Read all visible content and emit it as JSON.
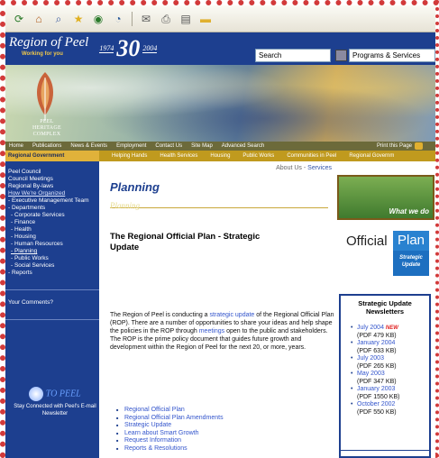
{
  "header": {
    "logo": "Region of Peel",
    "tagline": "Working for you",
    "year_start": "1974",
    "anniv_number": "30",
    "year_end": "2004",
    "anniv_caption": "years of working for you",
    "search_value": "Search",
    "services_select": "Programs & Services"
  },
  "banner": {
    "text_line1": "PEEL",
    "text_line2": "HERITAGE",
    "text_line3": "COMPLEX"
  },
  "nav": {
    "items": [
      "Home",
      "Publications",
      "News & Events",
      "Employment",
      "Contact Us",
      "Site Map",
      "Advanced Search"
    ],
    "print": "Print this Page"
  },
  "subnav": {
    "current": "Regional Government",
    "items": [
      "Helping Hands",
      "Health Services",
      "Housing",
      "Public Works",
      "Communities in Peel",
      "Regional Governm"
    ]
  },
  "sidebar": {
    "items": [
      "Peel Council",
      "Council Meetings",
      "Regional By-laws"
    ],
    "organized": "How We're Organized",
    "exec": "- Executive Management Team",
    "departments": "- Departments",
    "sub": [
      "- Corporate Services",
      "- Finance",
      "- Health",
      "- Housing",
      "- Human Resources",
      "- Planning",
      "- Public Works",
      "- Social Services"
    ],
    "reports": "- Reports",
    "comments": "Your Comments?",
    "connect_logo": "TO PEEL",
    "connect_text": "Stay Connected with Peel's E-mail Newsletter"
  },
  "main": {
    "breadcrumb_about": "About Us",
    "breadcrumb_sep": "- ",
    "breadcrumb_services": "Services",
    "title": "Planning",
    "watermark": "Planning",
    "heading": "The Regional Official Plan - Strategic Update",
    "body_1": "The Region of Peel is conducting a ",
    "body_link1": "strategic update",
    "body_2": " of the Regional Official Plan (ROP). There are a number of opportunities to share your ideas and help shape the policies in the ROP through ",
    "body_link2": "meetings",
    "body_3": " open to the public and stakeholders. The ROP is the prime policy document that guides future growth and development within the Region of Peel for the next 20, or more, years.",
    "links": [
      "Regional Official Plan",
      "Regional Official Plan Amendments",
      "Strategic Update",
      "Learn about Smart Growth",
      "Request Information",
      "Reports & Resolutions"
    ]
  },
  "right": {
    "what_we_do": "What we do",
    "official": "Official",
    "plan": "Plan",
    "plan_sub": "Strategic Update",
    "news_title": "Strategic Update Newsletters",
    "newsletters": [
      {
        "month": "July 2004",
        "size": "(PDF 479 KB)",
        "new": "NEW"
      },
      {
        "month": "January 2004",
        "size": "(PDF 633 KB)"
      },
      {
        "month": "July 2003",
        "size": "(PDF 265 KB)"
      },
      {
        "month": "May 2003",
        "size": "(PDF 347 KB)"
      },
      {
        "month": "January 2003",
        "size": "(PDF 1550 KB)"
      },
      {
        "month": "October 2002",
        "size": "(PDF 550 KB)"
      }
    ]
  }
}
